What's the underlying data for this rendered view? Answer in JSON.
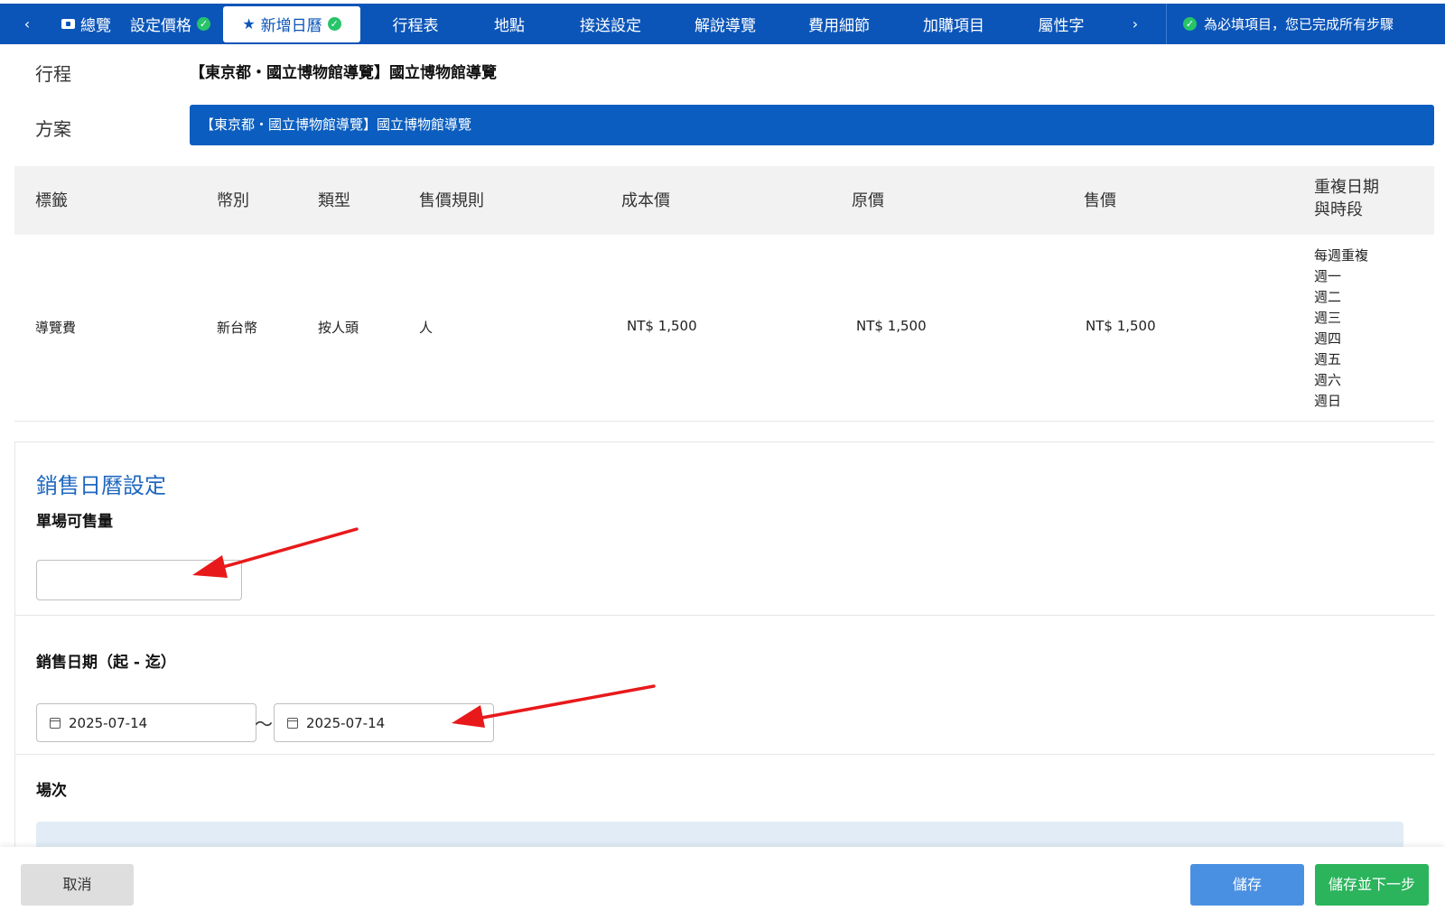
{
  "nav": {
    "prev_arrow": "‹",
    "next_arrow": "›",
    "tabs": [
      {
        "label": "總覽",
        "icon": "folder-icon",
        "done": false,
        "active": false
      },
      {
        "label": "設定價格",
        "done": true,
        "active": false
      },
      {
        "label": "新增日曆",
        "icon": "star-icon",
        "done": true,
        "active": true
      },
      {
        "label": "行程表",
        "done": false,
        "active": false
      },
      {
        "label": "地點",
        "done": false,
        "active": false
      },
      {
        "label": "接送設定",
        "done": false,
        "active": false
      },
      {
        "label": "解說導覽",
        "done": false,
        "active": false
      },
      {
        "label": "費用細節",
        "done": false,
        "active": false
      },
      {
        "label": "加購項目",
        "done": false,
        "active": false
      },
      {
        "label": "屬性字",
        "done": false,
        "active": false
      }
    ],
    "status_text": "為必填項目，您已完成所有步驟"
  },
  "info": {
    "trip_label": "行程",
    "trip_value": "【東京都・國立博物館導覽】國立博物館導覽",
    "plan_label": "方案",
    "plan_value": "【東京都・國立博物館導覽】國立博物館導覽"
  },
  "price_table": {
    "headers": {
      "tag": "標籤",
      "currency": "幣別",
      "type": "類型",
      "rule": "售價規則",
      "cost": "成本價",
      "original": "原價",
      "sale": "售價",
      "repeat_line1": "重複日期",
      "repeat_line2": "與時段"
    },
    "row": {
      "tag": "導覽費",
      "currency": "新台幣",
      "type": "按人頭",
      "rule": "人",
      "cost": "NT$ 1,500",
      "original": "NT$ 1,500",
      "sale": "NT$ 1,500",
      "repeat": [
        "每週重複",
        "週一",
        "週二",
        "週三",
        "週四",
        "週五",
        "週六",
        "週日"
      ]
    }
  },
  "calendar": {
    "title": "銷售日曆設定",
    "qty_label": "單場可售量",
    "qty_value": "",
    "date_label": "銷售日期（起 - 迄）",
    "date_from": "2025-07-14",
    "date_to": "2025-07-14",
    "date_separator": "～",
    "session_label": "場次"
  },
  "footer": {
    "cancel": "取消",
    "save": "儲存",
    "save_next": "儲存並下一步"
  },
  "colors": {
    "nav_bg": "#0b55b9",
    "accent_blue": "#1f68c0",
    "check_green": "#27c46a",
    "save_blue": "#4a90e2",
    "next_green": "#2bb45c",
    "annotation_red": "#e8191b"
  }
}
